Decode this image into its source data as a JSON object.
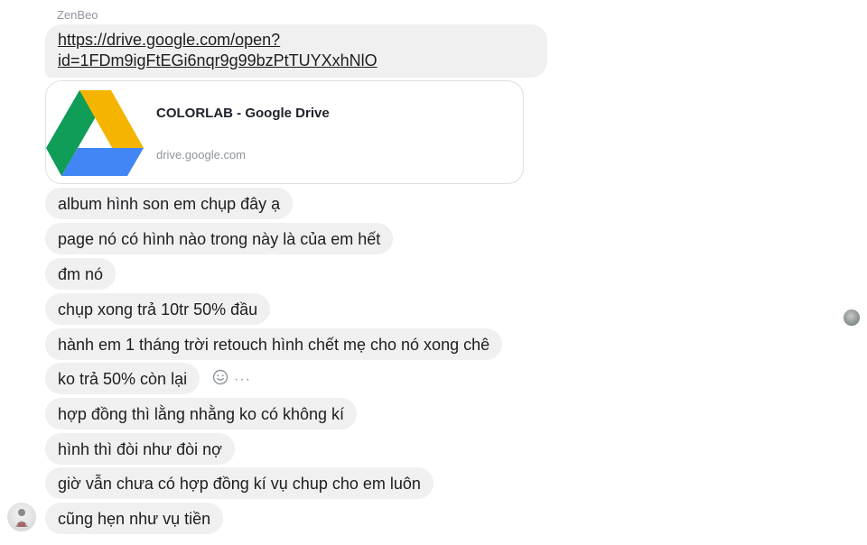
{
  "sender_name": "ZenBeo",
  "link": {
    "line1": "https://drive.google.com/open?",
    "line2": "id=1FDm9igFtEGi6nqr9g99bzPtTUYXxhNlO"
  },
  "link_preview": {
    "title": "COLORLAB - Google Drive",
    "domain": "drive.google.com",
    "thumbnail_icon": "google-drive-icon"
  },
  "messages": [
    "album hình son em chụp đây ạ",
    "page nó có hình nào trong này là của em hết",
    "đm nó",
    "chụp xong trả 10tr 50% đầu",
    "hành em 1 tháng trời retouch hình chết mẹ cho nó xong chê",
    "ko trả 50% còn lại",
    "hợp đồng thì lằng nhằng ko có không kí",
    "hình thì đòi như đòi nợ",
    "giờ vẫn chưa có hợp đồng kí vụ chup cho em luôn",
    "cũng hẹn như vụ tiền"
  ],
  "hover_actions": {
    "react_icon": "emoji-icon",
    "more_icon": "more-dots-icon",
    "more_label": "···"
  },
  "colors": {
    "bubble_bg": "#f1f0f0",
    "text": "#1c1e21",
    "meta_text": "#90949c"
  }
}
